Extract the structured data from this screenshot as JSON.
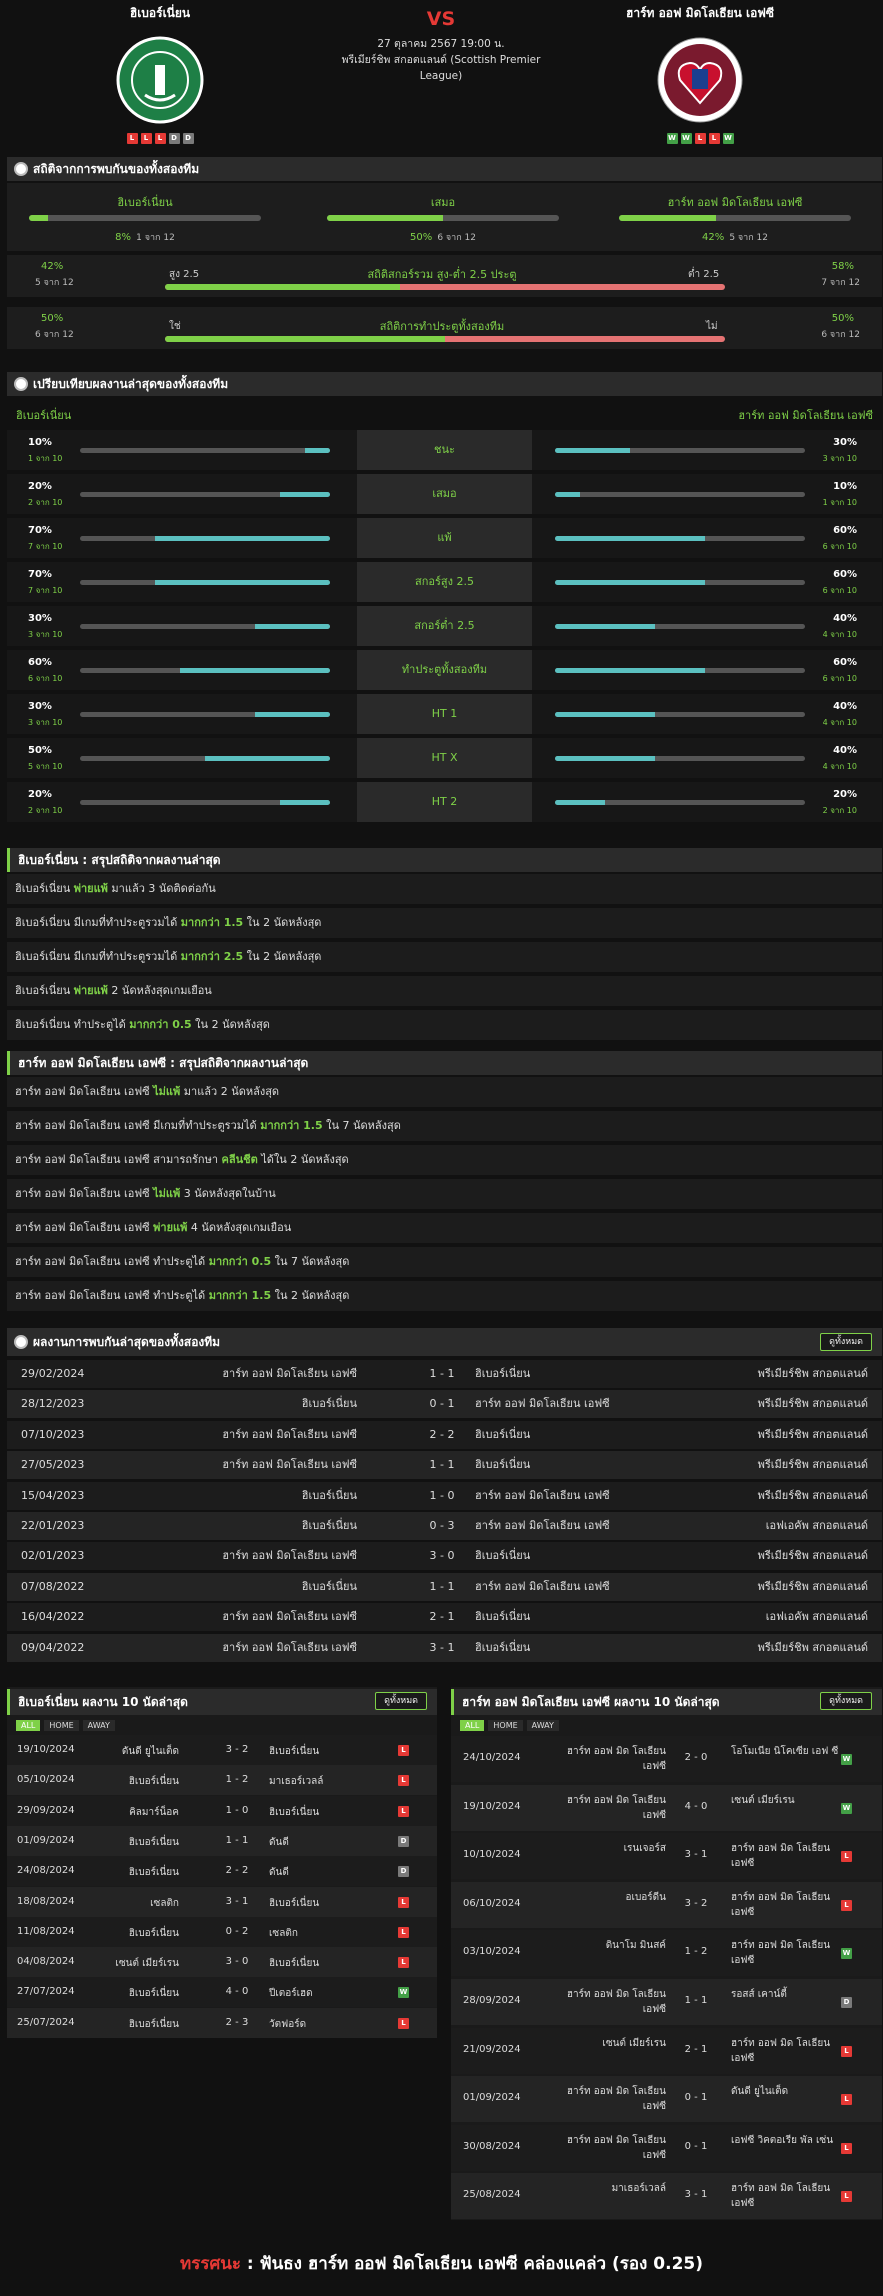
{
  "match": {
    "home": "ฮิเบอร์เนี่ยน",
    "away": "ฮาร์ท ออฟ มิดโลเธียน เอฟซี",
    "vs": "VS",
    "datetime": "27 ตุลาคม 2567 19:00 น.",
    "league": "พรีเมียร์ชิพ สกอตแลนด์ (Scottish Premier League)",
    "home_form": [
      "L",
      "L",
      "L",
      "D",
      "D"
    ],
    "away_form": [
      "W",
      "W",
      "L",
      "L",
      "W"
    ]
  },
  "h2h_stats": {
    "title": "สถิติจากการพบกันของทั้งสองทีม",
    "home_label": "ฮิเบอร์เนี่ยน",
    "home_pct": "8%",
    "home_sub": "1 จาก 12",
    "draw_label": "เสมอ",
    "draw_pct": "50%",
    "draw_sub": "6 จาก 12",
    "away_label": "ฮาร์ท ออฟ มิดโลเธียน เอฟซี",
    "away_pct": "42%",
    "away_sub": "5 จาก 12",
    "ou": {
      "left_pct": "42%",
      "left_sub": "5 จาก 12",
      "over": "สูง 2.5",
      "title": "สถิติสกอร์รวม สูง-ต่ำ 2.5 ประตู",
      "under": "ต่ำ 2.5",
      "right_pct": "58%",
      "right_sub": "7 จาก 12"
    },
    "btts": {
      "left_pct": "50%",
      "left_sub": "6 จาก 12",
      "yes": "ใช่",
      "title": "สถิติการทำประตูทั้งสองทีม",
      "no": "ไม่",
      "right_pct": "50%",
      "right_sub": "6 จาก 12"
    }
  },
  "compare": {
    "title": "เปรียบเทียบผลงานล่าสุดของทั้งสองทีม",
    "home": "ฮิเบอร์เนี่ยน",
    "away": "ฮาร์ท ออฟ มิดโลเธียน เอฟซี",
    "rows": [
      {
        "label": "ชนะ",
        "hv": "10%",
        "hs": "1 จาก 10",
        "av": "30%",
        "as": "3 จาก 10",
        "h": 0.1,
        "a": 0.3
      },
      {
        "label": "เสมอ",
        "hv": "20%",
        "hs": "2 จาก 10",
        "av": "10%",
        "as": "1 จาก 10",
        "h": 0.2,
        "a": 0.1
      },
      {
        "label": "แพ้",
        "hv": "70%",
        "hs": "7 จาก 10",
        "av": "60%",
        "as": "6 จาก 10",
        "h": 0.7,
        "a": 0.6
      },
      {
        "label": "สกอร์สูง 2.5",
        "hv": "70%",
        "hs": "7 จาก 10",
        "av": "60%",
        "as": "6 จาก 10",
        "h": 0.7,
        "a": 0.6
      },
      {
        "label": "สกอร์ต่ำ 2.5",
        "hv": "30%",
        "hs": "3 จาก 10",
        "av": "40%",
        "as": "4 จาก 10",
        "h": 0.3,
        "a": 0.4
      },
      {
        "label": "ทำประตูทั้งสองทีม",
        "hv": "60%",
        "hs": "6 จาก 10",
        "av": "60%",
        "as": "6 จาก 10",
        "h": 0.6,
        "a": 0.6
      },
      {
        "label": "HT 1",
        "hv": "30%",
        "hs": "3 จาก 10",
        "av": "40%",
        "as": "4 จาก 10",
        "h": 0.3,
        "a": 0.4
      },
      {
        "label": "HT X",
        "hv": "50%",
        "hs": "5 จาก 10",
        "av": "40%",
        "as": "4 จาก 10",
        "h": 0.5,
        "a": 0.4
      },
      {
        "label": "HT 2",
        "hv": "20%",
        "hs": "2 จาก 10",
        "av": "20%",
        "as": "2 จาก 10",
        "h": 0.2,
        "a": 0.2
      }
    ]
  },
  "home_summary": {
    "title": "ฮิเบอร์เนี่ยน : สรุปสถิติจากผลงานล่าสุด",
    "rows": [
      [
        "ฮิเบอร์เนี่ยน ",
        "พ่ายแพ้",
        " มาแล้ว 3 นัดติดต่อกัน"
      ],
      [
        "ฮิเบอร์เนี่ยน มีเกมที่ทำประตูรวมได้ ",
        "มากกว่า 1.5",
        " ใน 2 นัดหลังสุด"
      ],
      [
        "ฮิเบอร์เนี่ยน มีเกมที่ทำประตูรวมได้ ",
        "มากกว่า 2.5",
        " ใน 2 นัดหลังสุด"
      ],
      [
        "ฮิเบอร์เนี่ยน ",
        "พ่ายแพ้",
        " 2 นัดหลังสุดเกมเยือน"
      ],
      [
        "ฮิเบอร์เนี่ยน ทำประตูได้ ",
        "มากกว่า 0.5",
        " ใน 2 นัดหลังสุด"
      ]
    ]
  },
  "away_summary": {
    "title": "ฮาร์ท ออฟ มิดโลเธียน เอฟซี : สรุปสถิติจากผลงานล่าสุด",
    "rows": [
      [
        "ฮาร์ท ออฟ มิดโลเธียน เอฟซี ",
        "ไม่แพ้",
        " มาแล้ว 2 นัดหลังสุด"
      ],
      [
        "ฮาร์ท ออฟ มิดโลเธียน เอฟซี มีเกมที่ทำประตูรวมได้ ",
        "มากกว่า 1.5",
        " ใน 7 นัดหลังสุด"
      ],
      [
        "ฮาร์ท ออฟ มิดโลเธียน เอฟซี สามารถรักษา ",
        "คลีนชีต",
        " ได้ใน 2 นัดหลังสุด"
      ],
      [
        "ฮาร์ท ออฟ มิดโลเธียน เอฟซี ",
        "ไม่แพ้",
        " 3 นัดหลังสุดในบ้าน"
      ],
      [
        "ฮาร์ท ออฟ มิดโลเธียน เอฟซี ",
        "พ่ายแพ้",
        " 4 นัดหลังสุดเกมเยือน"
      ],
      [
        "ฮาร์ท ออฟ มิดโลเธียน เอฟซี ทำประตูได้ ",
        "มากกว่า 0.5",
        " ใน 7 นัดหลังสุด"
      ],
      [
        "ฮาร์ท ออฟ มิดโลเธียน เอฟซี ทำประตูได้ ",
        "มากกว่า 1.5",
        " ใน 2 นัดหลังสุด"
      ]
    ]
  },
  "h2h": {
    "title": "ผลงานการพบกันล่าสุดของทั้งสองทีม",
    "view_all": "ดูทั้งหมด",
    "rows": [
      [
        "29/02/2024",
        "ฮาร์ท ออฟ มิดโลเธียน เอฟซี",
        "1 - 1",
        "ฮิเบอร์เนี่ยน",
        "พรีเมียร์ชิพ สกอตแลนด์"
      ],
      [
        "28/12/2023",
        "ฮิเบอร์เนี่ยน",
        "0 - 1",
        "ฮาร์ท ออฟ มิดโลเธียน เอฟซี",
        "พรีเมียร์ชิพ สกอตแลนด์"
      ],
      [
        "07/10/2023",
        "ฮาร์ท ออฟ มิดโลเธียน เอฟซี",
        "2 - 2",
        "ฮิเบอร์เนี่ยน",
        "พรีเมียร์ชิพ สกอตแลนด์"
      ],
      [
        "27/05/2023",
        "ฮาร์ท ออฟ มิดโลเธียน เอฟซี",
        "1 - 1",
        "ฮิเบอร์เนี่ยน",
        "พรีเมียร์ชิพ สกอตแลนด์"
      ],
      [
        "15/04/2023",
        "ฮิเบอร์เนี่ยน",
        "1 - 0",
        "ฮาร์ท ออฟ มิดโลเธียน เอฟซี",
        "พรีเมียร์ชิพ สกอตแลนด์"
      ],
      [
        "22/01/2023",
        "ฮิเบอร์เนี่ยน",
        "0 - 3",
        "ฮาร์ท ออฟ มิดโลเธียน เอฟซี",
        "เอฟเอคัพ สกอตแลนด์"
      ],
      [
        "02/01/2023",
        "ฮาร์ท ออฟ มิดโลเธียน เอฟซี",
        "3 - 0",
        "ฮิเบอร์เนี่ยน",
        "พรีเมียร์ชิพ สกอตแลนด์"
      ],
      [
        "07/08/2022",
        "ฮิเบอร์เนี่ยน",
        "1 - 1",
        "ฮาร์ท ออฟ มิดโลเธียน เอฟซี",
        "พรีเมียร์ชิพ สกอตแลนด์"
      ],
      [
        "16/04/2022",
        "ฮาร์ท ออฟ มิดโลเธียน เอฟซี",
        "2 - 1",
        "ฮิเบอร์เนี่ยน",
        "เอฟเอคัพ สกอตแลนด์"
      ],
      [
        "09/04/2022",
        "ฮาร์ท ออฟ มิดโลเธียน เอฟซี",
        "3 - 1",
        "ฮิเบอร์เนี่ยน",
        "พรีเมียร์ชิพ สกอตแลนด์"
      ]
    ]
  },
  "home_last10": {
    "title": "ฮิเบอร์เนี่ยน ผลงาน 10 นัดล่าสุด",
    "view_all": "ดูทั้งหมด",
    "tabs": [
      "ALL",
      "HOME",
      "AWAY"
    ],
    "rows": [
      [
        "19/10/2024",
        "ดันดี ยูไนเต็ด",
        "3 - 2",
        "ฮิเบอร์เนี่ยน",
        "L"
      ],
      [
        "05/10/2024",
        "ฮิเบอร์เนี่ยน",
        "1 - 2",
        "มาเธอร์เวลล์",
        "L"
      ],
      [
        "29/09/2024",
        "คิลมาร์น็อค",
        "1 - 0",
        "ฮิเบอร์เนี่ยน",
        "L"
      ],
      [
        "01/09/2024",
        "ฮิเบอร์เนี่ยน",
        "1 - 1",
        "ดันดี",
        "D"
      ],
      [
        "24/08/2024",
        "ฮิเบอร์เนี่ยน",
        "2 - 2",
        "ดันดี",
        "D"
      ],
      [
        "18/08/2024",
        "เซลติก",
        "3 - 1",
        "ฮิเบอร์เนี่ยน",
        "L"
      ],
      [
        "11/08/2024",
        "ฮิเบอร์เนี่ยน",
        "0 - 2",
        "เซลติก",
        "L"
      ],
      [
        "04/08/2024",
        "เซนต์ เมียร์เรน",
        "3 - 0",
        "ฮิเบอร์เนี่ยน",
        "L"
      ],
      [
        "27/07/2024",
        "ฮิเบอร์เนี่ยน",
        "4 - 0",
        "ปีเตอร์เฮด",
        "W"
      ],
      [
        "25/07/2024",
        "ฮิเบอร์เนี่ยน",
        "2 - 3",
        "วัตฟอร์ด",
        "L"
      ]
    ]
  },
  "away_last10": {
    "title": "ฮาร์ท ออฟ มิดโลเธียน เอฟซี ผลงาน 10 นัดล่าสุด",
    "view_all": "ดูทั้งหมด",
    "tabs": [
      "ALL",
      "HOME",
      "AWAY"
    ],
    "rows": [
      [
        "24/10/2024",
        "ฮาร์ท ออฟ มิด โลเธียน เอฟซี",
        "2 - 0",
        "โอโมเนีย นิโคเซีย เอฟ ซี",
        "W"
      ],
      [
        "19/10/2024",
        "ฮาร์ท ออฟ มิด โลเธียน เอฟซี",
        "4 - 0",
        "เซนต์ เมียร์เรน",
        "W"
      ],
      [
        "10/10/2024",
        "เรนเจอร์ส",
        "3 - 1",
        "ฮาร์ท ออฟ มิด โลเธียน เอฟซี",
        "L"
      ],
      [
        "06/10/2024",
        "อเบอร์ดีน",
        "3 - 2",
        "ฮาร์ท ออฟ มิด โลเธียน เอฟซี",
        "L"
      ],
      [
        "03/10/2024",
        "ดินาโม มินสค์",
        "1 - 2",
        "ฮาร์ท ออฟ มิด โลเธียน เอฟซี",
        "W"
      ],
      [
        "28/09/2024",
        "ฮาร์ท ออฟ มิด โลเธียน เอฟซี",
        "1 - 1",
        "รอสส์ เคาน์ตี้",
        "D"
      ],
      [
        "21/09/2024",
        "เซนต์ เมียร์เรน",
        "2 - 1",
        "ฮาร์ท ออฟ มิด โลเธียน เอฟซี",
        "L"
      ],
      [
        "01/09/2024",
        "ฮาร์ท ออฟ มิด โลเธียน เอฟซี",
        "0 - 1",
        "ดันดี ยูไนเต็ด",
        "L"
      ],
      [
        "30/08/2024",
        "ฮาร์ท ออฟ มิด โลเธียน เอฟซี",
        "0 - 1",
        "เอฟซี วิคตอเรีย พัล เซ่น",
        "L"
      ],
      [
        "25/08/2024",
        "มาเธอร์เวลล์",
        "3 - 1",
        "ฮาร์ท ออฟ มิด โลเธียน เอฟซี",
        "L"
      ]
    ]
  },
  "prediction": {
    "label": "ทรรศนะ",
    "sep": " : ",
    "text": "ฟันธง ฮาร์ท ออฟ มิดโลเธียน เอฟซี คล่องแคล่ว (รอง 0.25)"
  },
  "colors": {
    "accent": "#7fd148",
    "loss": "#e53935",
    "draw": "#7a7a7a",
    "win": "#43a047",
    "teal": "#5bc0c0",
    "bg": "#111111"
  }
}
